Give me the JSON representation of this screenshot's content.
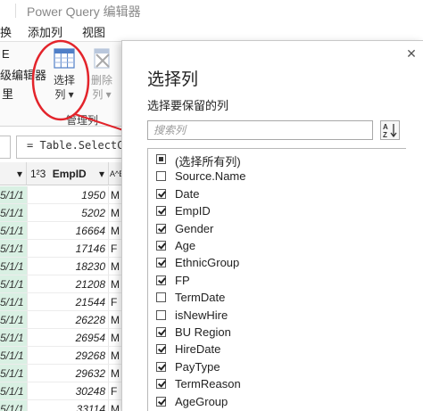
{
  "window": {
    "title": "Power Query 编辑器"
  },
  "menu": {
    "items": [
      "换",
      "添加列",
      "视图"
    ]
  },
  "ribbon": {
    "left_fragments": [
      "E",
      "级编辑器",
      "里"
    ],
    "choose_columns": "选择列",
    "choose_columns_line1": "选择",
    "choose_columns_line2": "列",
    "remove_columns_line1": "删除",
    "remove_columns_line2": "列",
    "group_label": "管理列"
  },
  "formula": {
    "text": "= Table.SelectCol"
  },
  "grid": {
    "headers": {
      "date_fragment": "▾",
      "emp_type": "1²3",
      "emp_label": "EmpID",
      "next_type": "A^B",
      "next_label": "A"
    },
    "rows": [
      {
        "date": "5/1/1",
        "emp": "1950",
        "g": "M"
      },
      {
        "date": "5/1/1",
        "emp": "5202",
        "g": "M"
      },
      {
        "date": "5/1/1",
        "emp": "16664",
        "g": "M"
      },
      {
        "date": "5/1/1",
        "emp": "17146",
        "g": "F"
      },
      {
        "date": "5/1/1",
        "emp": "18230",
        "g": "M"
      },
      {
        "date": "5/1/1",
        "emp": "21208",
        "g": "M"
      },
      {
        "date": "5/1/1",
        "emp": "21544",
        "g": "F"
      },
      {
        "date": "5/1/1",
        "emp": "26228",
        "g": "M"
      },
      {
        "date": "5/1/1",
        "emp": "26954",
        "g": "M"
      },
      {
        "date": "5/1/1",
        "emp": "29268",
        "g": "M"
      },
      {
        "date": "5/1/1",
        "emp": "29632",
        "g": "M"
      },
      {
        "date": "5/1/1",
        "emp": "30248",
        "g": "F"
      },
      {
        "date": "5/1/1",
        "emp": "33114",
        "g": "M"
      }
    ]
  },
  "dialog": {
    "title": "选择列",
    "subtitle": "选择要保留的列",
    "search_placeholder": "搜索列",
    "search_value": "",
    "sort_label": "A↓Z",
    "columns": [
      {
        "label": "(选择所有列)",
        "state": "partial"
      },
      {
        "label": "Source.Name",
        "state": "unchecked"
      },
      {
        "label": "Date",
        "state": "checked"
      },
      {
        "label": "EmpID",
        "state": "checked"
      },
      {
        "label": "Gender",
        "state": "checked"
      },
      {
        "label": "Age",
        "state": "checked"
      },
      {
        "label": "EthnicGroup",
        "state": "checked"
      },
      {
        "label": "FP",
        "state": "checked"
      },
      {
        "label": "TermDate",
        "state": "unchecked"
      },
      {
        "label": "isNewHire",
        "state": "unchecked"
      },
      {
        "label": "BU Region",
        "state": "checked"
      },
      {
        "label": "HireDate",
        "state": "checked"
      },
      {
        "label": "PayType",
        "state": "checked"
      },
      {
        "label": "TermReason",
        "state": "checked"
      },
      {
        "label": "AgeGroup",
        "state": "checked"
      }
    ]
  },
  "colors": {
    "highlight_red": "#e3242b",
    "date_column_bg": "#d9f0e3",
    "icon_blue": "#4f7fc7"
  }
}
